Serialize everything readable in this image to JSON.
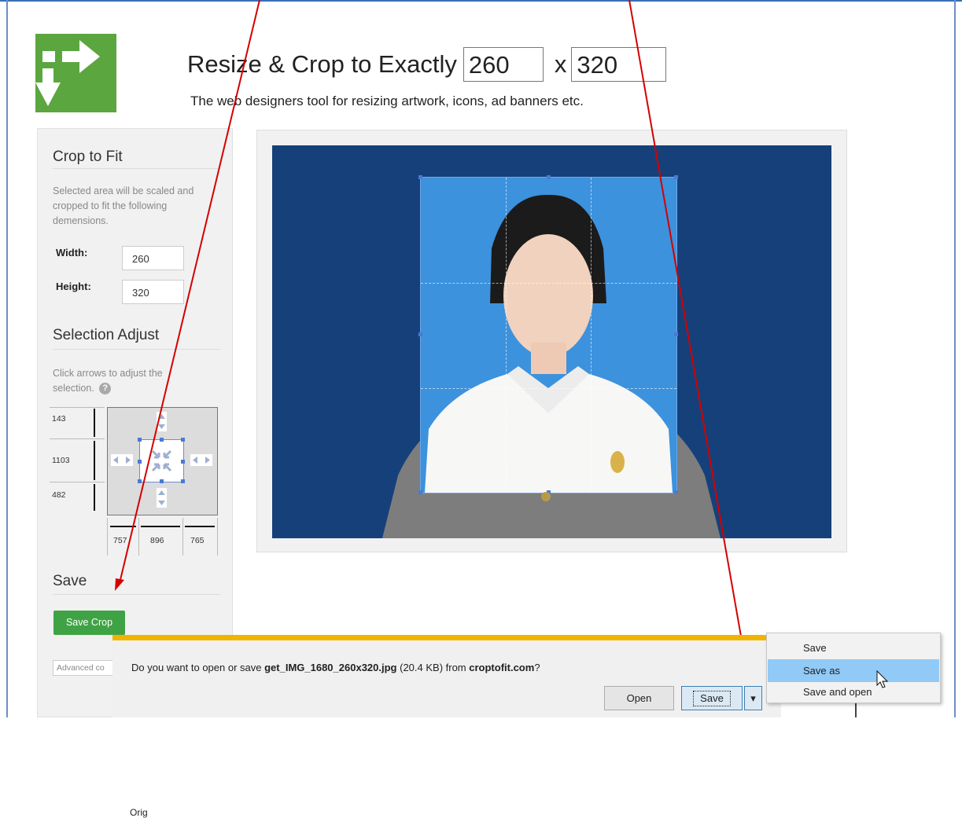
{
  "header": {
    "title": "Resize & Crop to Exactly",
    "width_value": "260",
    "x_separator": "x",
    "height_value": "320",
    "subtitle": "The web designers tool for resizing artwork, icons, ad banners etc."
  },
  "sidebar": {
    "crop_heading": "Crop to Fit",
    "crop_desc": "Selected area will be scaled and cropped to fit the following demensions.",
    "width_label": "Width:",
    "width_value": "260",
    "height_label": "Height:",
    "height_value": "320",
    "adjust_heading": "Selection Adjust",
    "adjust_desc": "Click arrows to adjust the selection.",
    "help_icon": "?",
    "adjust_values": {
      "top": "143",
      "middle": "1103",
      "bottom": "482",
      "left": "757",
      "center": "896",
      "right": "765"
    },
    "save_heading": "Save",
    "save_button": "Save Crop",
    "advanced_placeholder": "Advanced co",
    "original_label": "Orig"
  },
  "download_bar": {
    "prompt_prefix": "Do you want to open or save ",
    "filename": "get_IMG_1680_260x320.jpg",
    "size_text": " (20.4 KB) from ",
    "site": "croptofit.com",
    "suffix": "?",
    "open_button": "Open",
    "save_button": "Save",
    "dropdown_icon": "▾"
  },
  "save_menu": {
    "items": [
      "Save",
      "Save as",
      "Save and open"
    ],
    "selected_index": 1
  },
  "colors": {
    "logo_green": "#5ba63f",
    "save_green": "#3fa345",
    "photo_bg": "#16407a",
    "selection_blue": "#3c92dd",
    "annotation_red": "#d40000",
    "bar_accent": "#f0b400"
  },
  "icons": {
    "logo": "resize-arrows-logo",
    "cursor": "mouse-pointer-icon"
  }
}
